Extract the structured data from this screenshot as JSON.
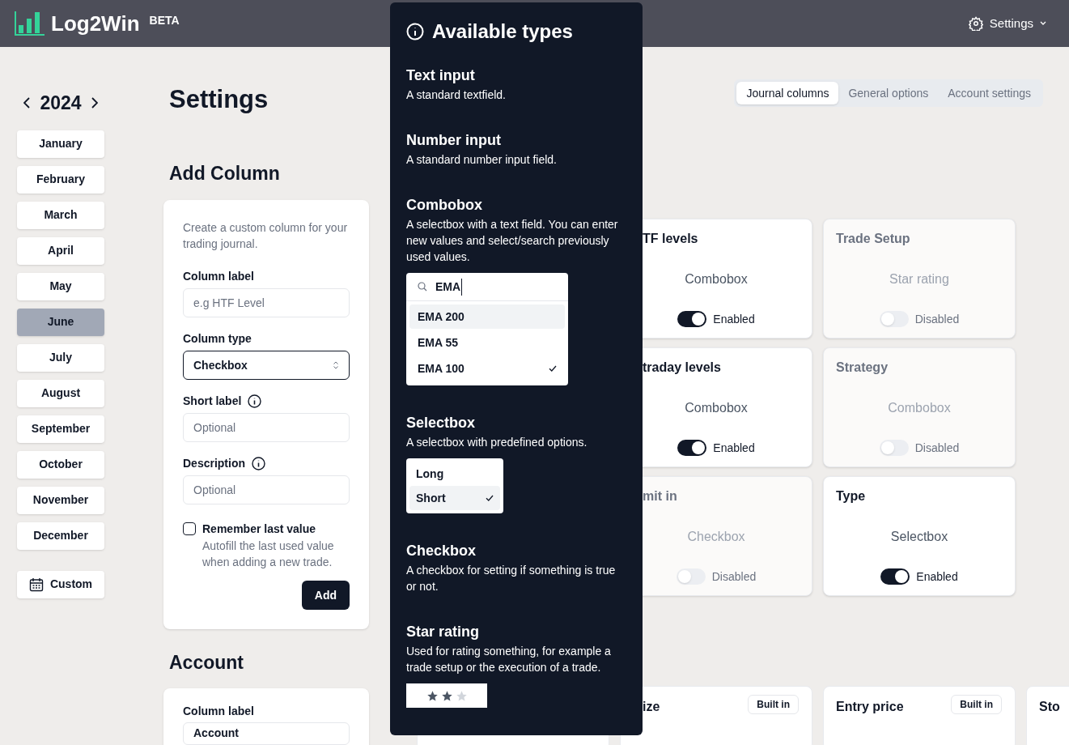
{
  "header": {
    "logo": "Log2Win",
    "badge": "BETA",
    "settings_menu": "Settings"
  },
  "sidebar": {
    "year": "2024",
    "months": [
      {
        "label": "January",
        "selected": false
      },
      {
        "label": "February",
        "selected": false
      },
      {
        "label": "March",
        "selected": false
      },
      {
        "label": "April",
        "selected": false
      },
      {
        "label": "May",
        "selected": false
      },
      {
        "label": "June",
        "selected": true
      },
      {
        "label": "July",
        "selected": false
      },
      {
        "label": "August",
        "selected": false
      },
      {
        "label": "September",
        "selected": false
      },
      {
        "label": "October",
        "selected": false
      },
      {
        "label": "November",
        "selected": false
      },
      {
        "label": "December",
        "selected": false
      }
    ],
    "custom": "Custom"
  },
  "page_title": "Settings",
  "tabs": [
    {
      "label": "Journal columns",
      "selected": true
    },
    {
      "label": "General options",
      "selected": false
    },
    {
      "label": "Account settings",
      "selected": false
    }
  ],
  "add_column": {
    "heading": "Add Column",
    "intro": "Create a custom column for your trading journal.",
    "fields": [
      {
        "kind": "text",
        "label": "Column label",
        "placeholder": "e.g HTF Level",
        "info": false
      },
      {
        "kind": "select",
        "label": "Column type",
        "value": "Checkbox",
        "info": false
      },
      {
        "kind": "text",
        "label": "Short label",
        "placeholder": "Optional",
        "info": true
      },
      {
        "kind": "text",
        "label": "Description",
        "placeholder": "Optional",
        "info": true
      }
    ],
    "remember": {
      "label": "Remember last value",
      "hint": "Autofill the last used value when adding a new trade.",
      "checked": false
    },
    "button": "Add"
  },
  "account": {
    "heading": "Account",
    "field_label": "Column label",
    "field_value": "Account"
  },
  "column_cards": [
    {
      "title": "TF levels",
      "type": "Combobox",
      "enabled": true,
      "status": "Enabled"
    },
    {
      "title": "Trade Setup",
      "type": "Star rating",
      "enabled": false,
      "status": "Disabled"
    },
    {
      "title": "traday levels",
      "type": "Combobox",
      "enabled": true,
      "status": "Enabled"
    },
    {
      "title": "Strategy",
      "type": "Combobox",
      "enabled": false,
      "status": "Disabled"
    },
    {
      "title": "mit in",
      "type": "Checkbox",
      "enabled": false,
      "status": "Disabled"
    },
    {
      "title": "Type",
      "type": "Selectbox",
      "enabled": true,
      "status": "Enabled"
    }
  ],
  "builtin_cards": [
    {
      "title": "ize",
      "badge": "Built in"
    },
    {
      "title": "Entry price",
      "badge": "Built in"
    },
    {
      "title": "Sto"
    }
  ],
  "types_popover": {
    "title": "Available types",
    "types": [
      {
        "kind": "plain",
        "name": "Text input",
        "description": "A standard textfield."
      },
      {
        "kind": "plain",
        "name": "Number input",
        "description": "A standard number input field."
      },
      {
        "kind": "combobox",
        "name": "Combobox",
        "description": "A selectbox with a text field. You can enter new values and select/search previously used values.",
        "query": "EMA",
        "options": [
          {
            "label": "EMA 200",
            "highlighted": true,
            "selected": false
          },
          {
            "label": "EMA 55",
            "highlighted": false,
            "selected": false
          },
          {
            "label": "EMA 100",
            "highlighted": false,
            "selected": true
          }
        ]
      },
      {
        "kind": "select",
        "name": "Selectbox",
        "description": "A selectbox with predefined options.",
        "options": [
          {
            "label": "Long",
            "highlighted": false,
            "selected": false
          },
          {
            "label": "Short",
            "highlighted": true,
            "selected": true
          }
        ]
      },
      {
        "kind": "plain",
        "name": "Checkbox",
        "description": "A checkbox for setting if something is true or not."
      },
      {
        "kind": "stars",
        "name": "Star rating",
        "description": "Used for rating something, for example a trade setup or the execution of a trade.",
        "stars": 2
      }
    ]
  }
}
